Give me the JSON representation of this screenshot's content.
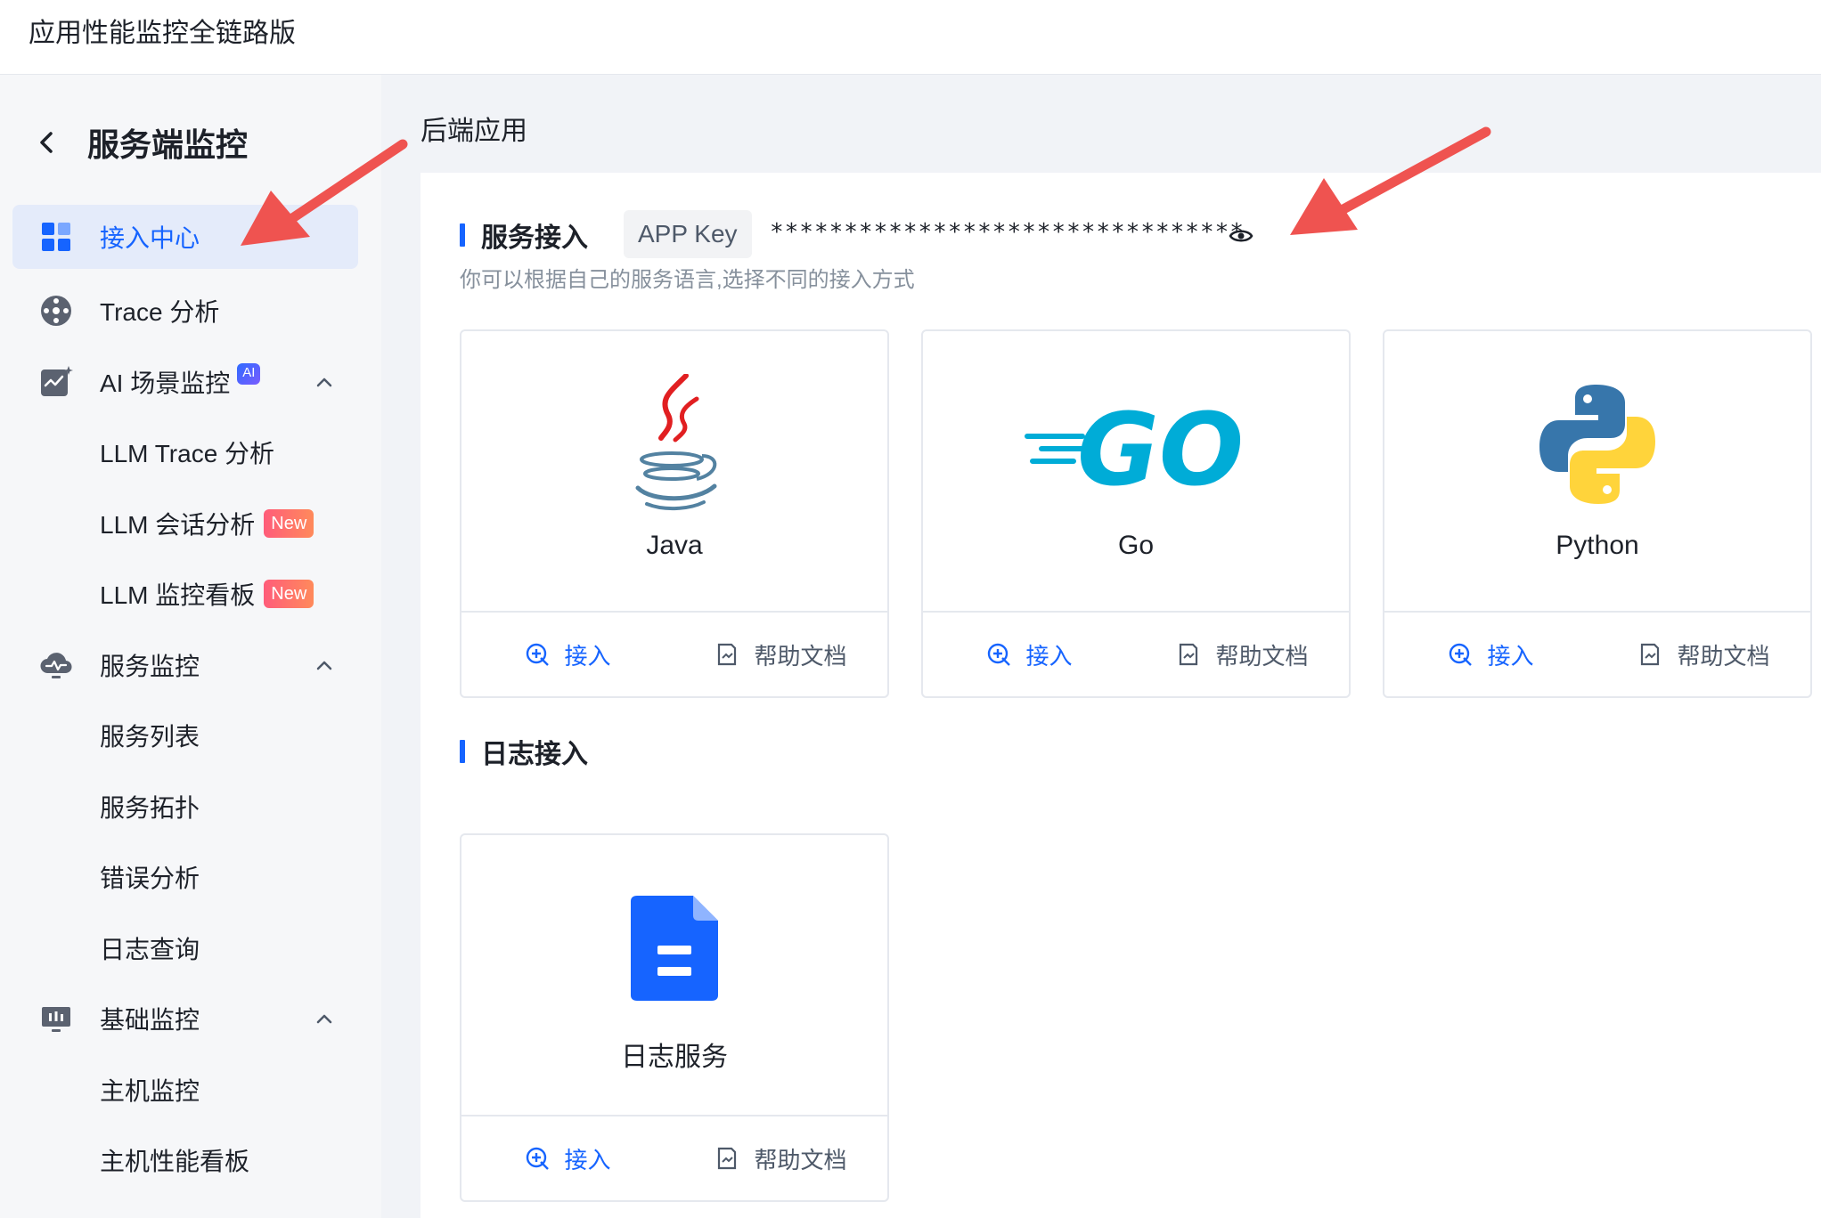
{
  "app": {
    "title": "应用性能监控全链路版"
  },
  "sidebar": {
    "title": "服务端监控",
    "items": [
      {
        "label": "接入中心",
        "active": true
      },
      {
        "label": "Trace 分析"
      },
      {
        "label": "AI 场景监控",
        "badge": "AI"
      },
      {
        "label": "LLM Trace 分析"
      },
      {
        "label": "LLM 会话分析",
        "badge": "New"
      },
      {
        "label": "LLM 监控看板",
        "badge": "New"
      },
      {
        "label": "服务监控"
      },
      {
        "label": "服务列表"
      },
      {
        "label": "服务拓扑"
      },
      {
        "label": "错误分析"
      },
      {
        "label": "日志查询"
      },
      {
        "label": "基础监控"
      },
      {
        "label": "主机监控"
      },
      {
        "label": "主机性能看板"
      }
    ]
  },
  "main": {
    "heading": "后端应用",
    "service_section": {
      "title": "服务接入",
      "appkey_label": "APP Key",
      "appkey_value": "********************************",
      "description": "你可以根据自己的服务语言,选择不同的接入方式"
    },
    "log_section": {
      "title": "日志接入"
    },
    "cards": [
      {
        "name": "Java",
        "connect": "接入",
        "docs": "帮助文档"
      },
      {
        "name": "Go",
        "logo_text": "GO",
        "connect": "接入",
        "docs": "帮助文档"
      },
      {
        "name": "Python",
        "connect": "接入",
        "docs": "帮助文档"
      },
      {
        "name": "日志服务",
        "connect": "接入",
        "docs": "帮助文档"
      }
    ]
  },
  "colors": {
    "accent": "#1664ff",
    "arrow": "#ef5350",
    "go": "#00acd7",
    "java_red": "#e11f21",
    "java_blue": "#5382a1",
    "python_blue": "#3776ab",
    "python_yellow": "#ffd43b",
    "doc_blue": "#1664ff"
  }
}
